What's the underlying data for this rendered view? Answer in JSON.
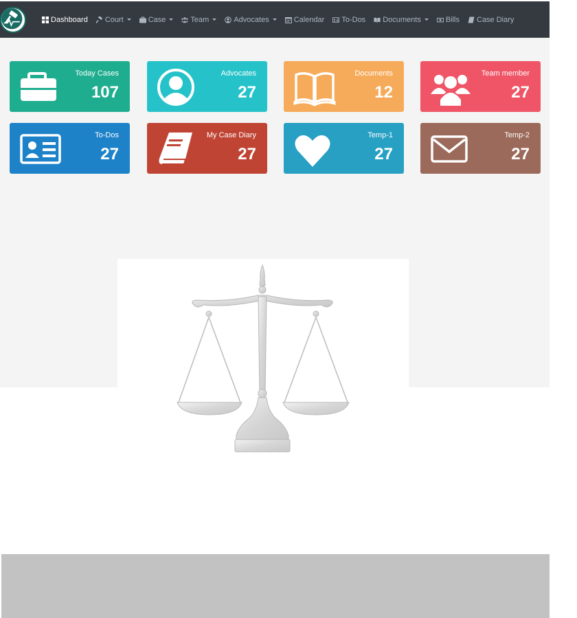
{
  "nav": {
    "items": [
      {
        "label": "Dashboard",
        "icon": "grid-icon",
        "active": true
      },
      {
        "label": "Court",
        "icon": "gavel-icon",
        "dropdown": true
      },
      {
        "label": "Case",
        "icon": "briefcase-icon",
        "dropdown": true
      },
      {
        "label": "Team",
        "icon": "users-icon",
        "dropdown": true
      },
      {
        "label": "Advocates",
        "icon": "user-circle-icon",
        "dropdown": true
      },
      {
        "label": "Calendar",
        "icon": "calendar-icon"
      },
      {
        "label": "To-Dos",
        "icon": "id-card-icon"
      },
      {
        "label": "Documents",
        "icon": "book-open-icon",
        "dropdown": true
      },
      {
        "label": "Bills",
        "icon": "money-bill-icon"
      },
      {
        "label": "Case Diary",
        "icon": "book-icon"
      }
    ]
  },
  "cards": [
    {
      "label": "Today Cases",
      "count": "107",
      "color": "#1fad8f",
      "icon": "briefcase-icon"
    },
    {
      "label": "Advocates",
      "count": "27",
      "color": "#25c3c9",
      "icon": "user-circle-icon"
    },
    {
      "label": "Documents",
      "count": "12",
      "color": "#f6ab5a",
      "icon": "book-open-icon"
    },
    {
      "label": "Team member",
      "count": "27",
      "color": "#ef5566",
      "icon": "users-icon"
    },
    {
      "label": "To-Dos",
      "count": "27",
      "color": "#1e82c9",
      "icon": "id-card-icon"
    },
    {
      "label": "My Case Diary",
      "count": "27",
      "color": "#c04434",
      "icon": "book-icon"
    },
    {
      "label": "Temp-1",
      "count": "27",
      "color": "#27a0c4",
      "icon": "heart-icon"
    },
    {
      "label": "Temp-2",
      "count": "27",
      "color": "#9b6a5a",
      "icon": "envelope-icon"
    }
  ],
  "colors": {
    "navbar": "#343a40",
    "content_bg": "#f4f4f4",
    "footer": "#c2c2c2"
  }
}
